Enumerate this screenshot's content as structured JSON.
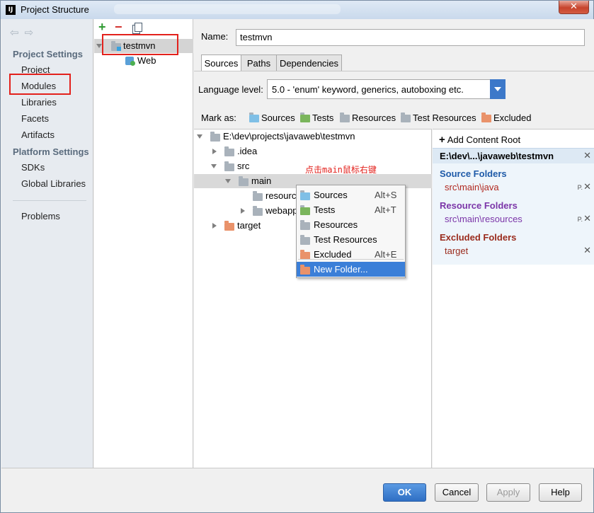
{
  "window": {
    "title": "Project Structure",
    "app_icon": "IJ",
    "close_label": "✕"
  },
  "sidebar": {
    "project_settings_title": "Project Settings",
    "project_items": [
      "Project",
      "Modules",
      "Libraries",
      "Facets",
      "Artifacts"
    ],
    "platform_settings_title": "Platform Settings",
    "platform_items": [
      "SDKs",
      "Global Libraries"
    ],
    "other_items": [
      "Problems"
    ],
    "selected": "Modules"
  },
  "modules": {
    "toolbar": {
      "add": "+",
      "remove": "−"
    },
    "tree": [
      {
        "label": "testmvn",
        "selected": true
      },
      {
        "label": "Web"
      }
    ]
  },
  "main": {
    "name_label": "Name:",
    "name_value": "testmvn",
    "tabs": [
      "Sources",
      "Paths",
      "Dependencies"
    ],
    "active_tab": "Sources",
    "language_label": "Language level:",
    "language_value": "5.0 - 'enum' keyword, generics, autoboxing etc.",
    "mark_as_label": "Mark as:",
    "mark_as": [
      {
        "label": "Sources",
        "color": "#7fbfe6"
      },
      {
        "label": "Tests",
        "color": "#7ab55c"
      },
      {
        "label": "Resources",
        "color": "#a9b2bb"
      },
      {
        "label": "Test Resources",
        "color": "#a9b2bb"
      },
      {
        "label": "Excluded",
        "color": "#e9926a"
      }
    ]
  },
  "content_tree": {
    "root": "E:\\dev\\projects\\javaweb\\testmvn",
    "nodes": [
      ".idea",
      "src",
      "main",
      "resourc",
      "webapp",
      "target"
    ]
  },
  "annotation": "点击main鼠标右键",
  "context_menu": {
    "items": [
      {
        "label": "Sources",
        "shortcut": "Alt+S",
        "color": "#7fbfe6"
      },
      {
        "label": "Tests",
        "shortcut": "Alt+T",
        "color": "#7ab55c"
      },
      {
        "label": "Resources",
        "shortcut": "",
        "color": "#a9b2bb"
      },
      {
        "label": "Test Resources",
        "shortcut": "",
        "color": "#a9b2bb"
      },
      {
        "label": "Excluded",
        "shortcut": "Alt+E",
        "color": "#e9926a"
      },
      {
        "label": "New Folder...",
        "shortcut": "",
        "color": "#e9926a",
        "selected": true
      }
    ]
  },
  "content_roots": {
    "add_label": "Add Content Root",
    "root_path": "E:\\dev\\...\\javaweb\\testmvn",
    "source_title": "Source Folders",
    "source_value": "src\\main\\java",
    "source_color": "#1e5aa8",
    "source_value_color": "#b1281f",
    "resource_title": "Resource Folders",
    "resource_value": "src\\main\\resources",
    "resource_color": "#7b35a8",
    "resource_value_color": "#7b35a8",
    "excluded_title": "Excluded Folders",
    "excluded_value": "target",
    "excluded_color": "#9a2b1d",
    "excluded_value_color": "#9a2b1d"
  },
  "buttons": {
    "ok": "OK",
    "cancel": "Cancel",
    "apply": "Apply",
    "help": "Help"
  }
}
